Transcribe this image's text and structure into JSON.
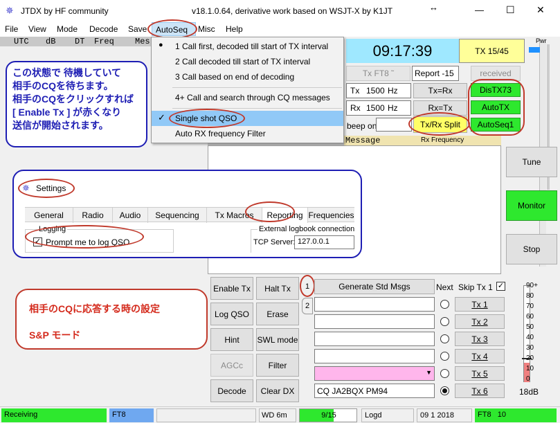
{
  "titlebar": {
    "app_name": "JTDX  by HF community",
    "version": "v18.1.0.64, derivative work based on WSJT-X by K1JT",
    "resize_glyph": "↔",
    "minimize": "—",
    "maximize": "☐",
    "close": "✕"
  },
  "menubar": [
    "File",
    "View",
    "Mode",
    "Decode",
    "Save",
    "AutoSeq",
    "Misc",
    "Help"
  ],
  "band_header": {
    "utc": "UTC",
    "db": "dB",
    "dt": "DT",
    "freq": "Freq",
    "mes": "Mes"
  },
  "autoseq_menu": {
    "items": [
      "1  Call first, decoded till start of TX interval",
      "2  Call decoded till start of TX interval",
      "3  Call based on end of decoding",
      "4+ Call and search through CQ messages",
      "Single shot QSO",
      "Auto RX frequency Filter"
    ],
    "check_mark": "✓",
    "radio_dot": "●"
  },
  "clock": {
    "time": "09:17:39",
    "tx_label": "TX 15/45"
  },
  "controls": {
    "tx_mode": "Tx FT8 ˜",
    "report": "Report -15",
    "received": "received",
    "tx_label": "Tx",
    "tx_freq": "1500",
    "rx_label": "Rx",
    "rx_freq": "1500",
    "hz": "Hz",
    "tx_eq_rx": "Tx=Rx",
    "rx_eq_tx": "Rx=Tx",
    "dis_tx73": "DisTX73",
    "auto_tx": "AutoTX",
    "auto_seq1": "AutoSeq1",
    "beep_on": "beep on",
    "tx_rx_split": "Tx/Rx Split",
    "rx_frequency": "Rx Frequency",
    "message_col": "Message",
    "pwr_label": "Pwr"
  },
  "right_buttons": {
    "tune": "Tune",
    "monitor": "Monitor",
    "stop": "Stop"
  },
  "note_blue": [
    "この状態で 待機していて",
    "相手のCQを待ちます。",
    "相手のCQをクリックすれば",
    "[ Enable Tx ] が赤くなり",
    "送信が開始されます。"
  ],
  "settings": {
    "title": "Settings",
    "tabs": [
      "General",
      "Radio",
      "Audio",
      "Sequencing",
      "Tx Macros",
      "Reporting",
      "Frequencies"
    ],
    "logging_group": "Logging",
    "prompt_log": "Prompt me to log QSO",
    "prompt_checked": "✓",
    "ext_logbook": "External logbook connection",
    "tcp_server": "TCP Server:",
    "tcp_value": "127.0.0.1"
  },
  "note_red": {
    "line1": "相手のCQに応答する時の設定",
    "line2": "S&P  モード"
  },
  "left_buttons": [
    "Enable Tx",
    "Halt Tx",
    "Log QSO",
    "Erase",
    "Hint",
    "SWL mode",
    "AGCc",
    "Filter",
    "Decode",
    "Clear DX"
  ],
  "tx_panel": {
    "tab1": "1",
    "tab2": "2",
    "generate": "Generate Std Msgs",
    "next": "Next",
    "skip_tx1": "Skip Tx 1",
    "skip_checked": "✓",
    "tx_buttons": [
      "Tx 1",
      "Tx 2",
      "Tx 3",
      "Tx 4",
      "Tx 5",
      "Tx 6"
    ],
    "tx6_message": "CQ JA2BQX PM94",
    "dropdown_arrow": "▼"
  },
  "meter": {
    "ticks": [
      "90+",
      "80",
      "70",
      "60",
      "50",
      "40",
      "30",
      "20",
      "10",
      "0"
    ],
    "reading": "18dB",
    "level_db": 18
  },
  "statusbar": {
    "receiving": "Receiving",
    "mode": "FT8",
    "wd": "WD 6m",
    "progress": "9/15",
    "progress_fraction": 0.6,
    "logd": "Logd",
    "date": "09 1 2018",
    "mode_period": "FT8   10"
  },
  "colors": {
    "accent_blue": "#1e1eb4",
    "annotation_red": "#c0392b",
    "clock_bg": "#9fe8ff",
    "tx_yellow": "#ffff99",
    "active_green": "#2ee82e",
    "menu_highlight": "#91c9f7"
  }
}
